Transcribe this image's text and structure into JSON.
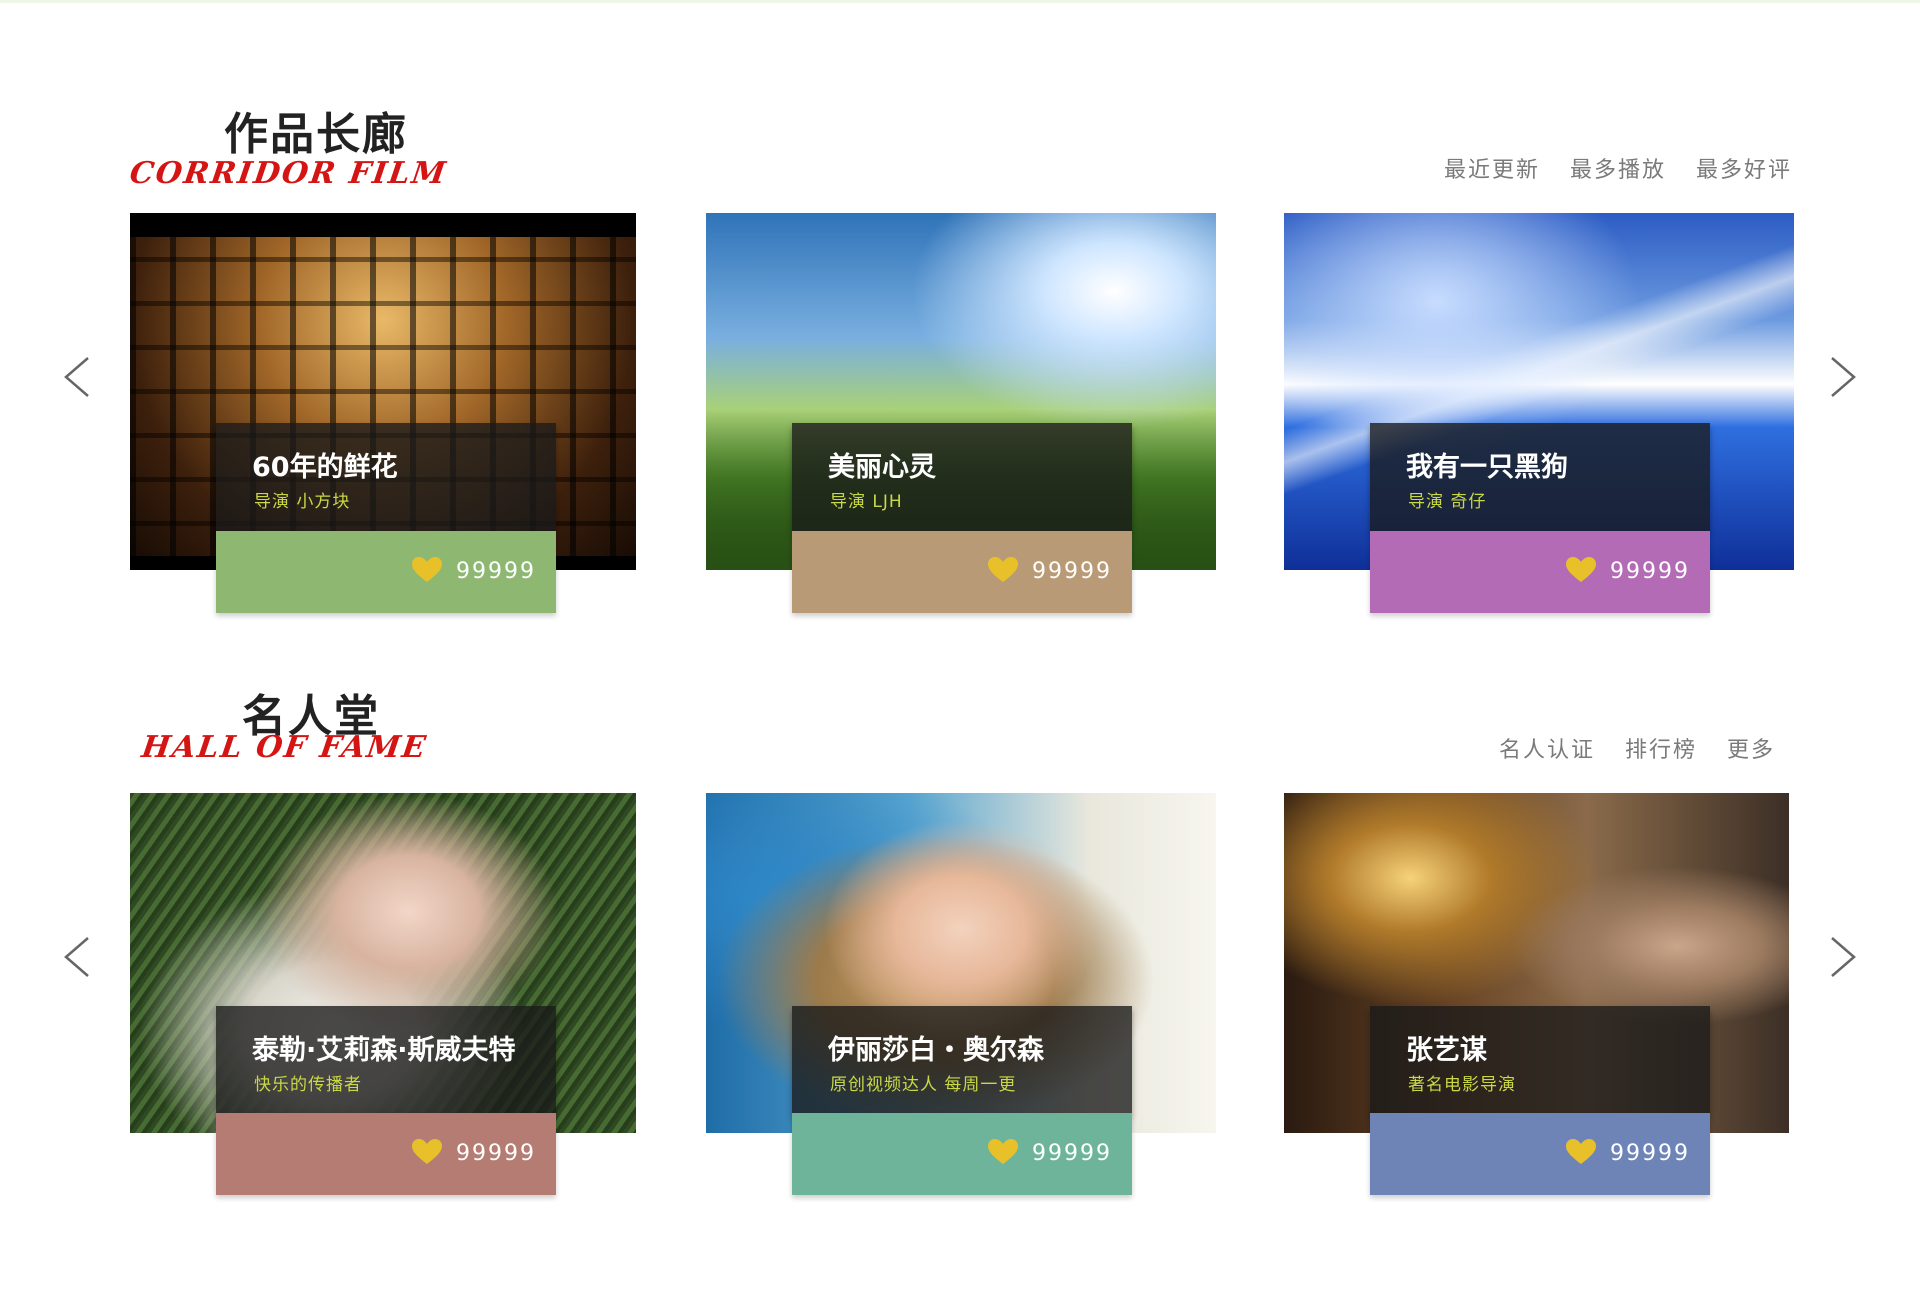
{
  "corridor": {
    "title_cn": "作品长廊",
    "title_en": "CORRIDOR FILM",
    "filters": [
      "最近更新",
      "最多播放",
      "最多好评"
    ],
    "cards": [
      {
        "title": "60年的鲜花",
        "subtitle": "导演 小方块",
        "likes": "99999",
        "color": "#8eb872"
      },
      {
        "title": "美丽心灵",
        "subtitle": "导演 LJH",
        "likes": "99999",
        "color": "#b89a76"
      },
      {
        "title": "我有一只黑狗",
        "subtitle": "导演 奇仔",
        "likes": "99999",
        "color": "#b36bb5"
      }
    ]
  },
  "fame": {
    "title_cn": "名人堂",
    "title_en": "HALL OF FAME",
    "filters": [
      "名人认证",
      "排行榜",
      "更多"
    ],
    "cards": [
      {
        "title": "泰勒·艾莉森·斯威夫特",
        "subtitle": "快乐的传播者",
        "likes": "99999",
        "color": "#b47c72"
      },
      {
        "title": "伊丽莎白・奥尔森",
        "subtitle": "原创视频达人 每周一更",
        "likes": "99999",
        "color": "#6db49a"
      },
      {
        "title": "张艺谋",
        "subtitle": "著名电影导演",
        "likes": "99999",
        "color": "#6f84b6"
      }
    ]
  },
  "colors": {
    "heart": "#e8c12a",
    "accent_red": "#d51414",
    "subtitle": "#c9d945"
  },
  "icons": {
    "prev": "chevron-left-icon",
    "next": "chevron-right-icon",
    "like": "heart-icon"
  }
}
